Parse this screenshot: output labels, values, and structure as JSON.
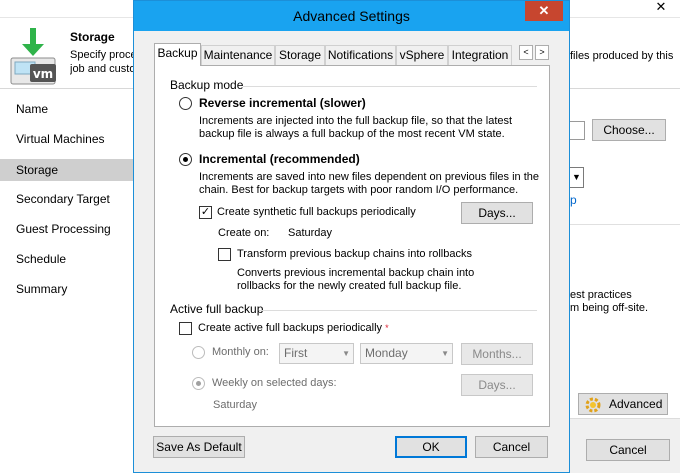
{
  "background": {
    "close_glyph": "✕",
    "header_title": "Storage",
    "header_desc_1": "Specify proce",
    "header_desc_2": "job and custo",
    "header_desc_right_1": "files produced by this",
    "nav_items": [
      {
        "label": "Name"
      },
      {
        "label": "Virtual Machines"
      },
      {
        "label": "Storage"
      },
      {
        "label": "Secondary Target"
      },
      {
        "label": "Guest Processing"
      },
      {
        "label": "Schedule"
      },
      {
        "label": "Summary"
      }
    ],
    "active_nav": "Storage",
    "choose_label": "Choose...",
    "link_fragment": "p",
    "note_line_1": "est practices",
    "note_line_2": "m being off-site.",
    "advanced_label": "Advanced",
    "cancel_label": "Cancel"
  },
  "dialog": {
    "title": "Advanced Settings",
    "close_glyph": "✕",
    "tabs": [
      {
        "label": "Backup"
      },
      {
        "label": "Maintenance"
      },
      {
        "label": "Storage"
      },
      {
        "label": "Notifications"
      },
      {
        "label": "vSphere"
      },
      {
        "label": "Integration"
      }
    ],
    "active_tab": "Backup",
    "tab_scroll_left": "<",
    "tab_scroll_right": ">",
    "backup_mode": {
      "group_label": "Backup mode",
      "reverse": {
        "label": "Reverse incremental (slower)",
        "selected": false,
        "desc_1": "Increments are injected into the full backup file, so that the latest",
        "desc_2": "backup file is always a full backup of the most recent VM state."
      },
      "incremental": {
        "label": "Incremental (recommended)",
        "selected": true,
        "desc_1": "Increments are saved into new files dependent on previous files in the",
        "desc_2": "chain. Best for backup targets with poor random I/O performance."
      },
      "synthetic": {
        "label": "Create synthetic full backups periodically",
        "checked": true,
        "days_label": "Days...",
        "create_on_label": "Create on:",
        "create_on_value": "Saturday"
      },
      "transform": {
        "label": "Transform previous backup chains into rollbacks",
        "checked": false,
        "desc_1": "Converts previous incremental backup chain into",
        "desc_2": "rollbacks for the newly created full backup file."
      }
    },
    "active_full": {
      "group_label": "Active full backup",
      "create_label": "Create active full backups periodically",
      "required_mark": "*",
      "checked": false,
      "monthly": {
        "label": "Monthly on:",
        "selected": false,
        "week_value": "First",
        "day_value": "Monday",
        "months_label": "Months..."
      },
      "weekly": {
        "label": "Weekly on selected days:",
        "selected": true,
        "days_label": "Days...",
        "days_value": "Saturday"
      }
    },
    "save_default_label": "Save As Default",
    "ok_label": "OK",
    "cancel_label": "Cancel"
  },
  "colors": {
    "title_bar": "#19a3f0",
    "close_button": "#c7462f",
    "active_nav": "#cfcfcf",
    "link": "#0066cc"
  }
}
